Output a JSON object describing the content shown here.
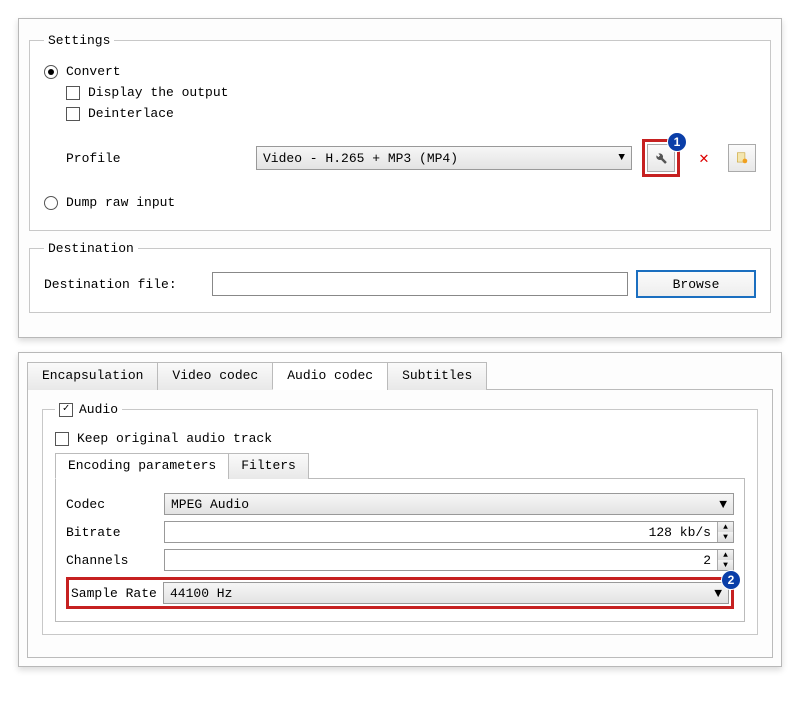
{
  "settings": {
    "legend": "Settings",
    "convert_label": "Convert",
    "convert_selected": true,
    "display_output_label": "Display the output",
    "display_output_checked": false,
    "deinterlace_label": "Deinterlace",
    "deinterlace_checked": false,
    "profile_label": "Profile",
    "profile_value": "Video - H.265 + MP3 (MP4)",
    "dump_raw_label": "Dump raw input",
    "dump_raw_selected": false
  },
  "annotations": {
    "badge1": "1",
    "badge2": "2"
  },
  "destination": {
    "legend": "Destination",
    "file_label": "Destination file:",
    "file_value": "",
    "browse_label": "Browse"
  },
  "tabs": {
    "encapsulation": "Encapsulation",
    "video_codec": "Video codec",
    "audio_codec": "Audio codec",
    "subtitles": "Subtitles",
    "active": "audio_codec"
  },
  "audio": {
    "audio_label": "Audio",
    "audio_checked": true,
    "keep_original_label": "Keep original audio track",
    "keep_original_checked": false,
    "sub_tabs": {
      "encoding": "Encoding parameters",
      "filters": "Filters",
      "active": "encoding"
    },
    "codec_label": "Codec",
    "codec_value": "MPEG Audio",
    "bitrate_label": "Bitrate",
    "bitrate_value": "128 kb/s",
    "channels_label": "Channels",
    "channels_value": "2",
    "sample_rate_label": "Sample Rate",
    "sample_rate_value": "44100 Hz"
  }
}
